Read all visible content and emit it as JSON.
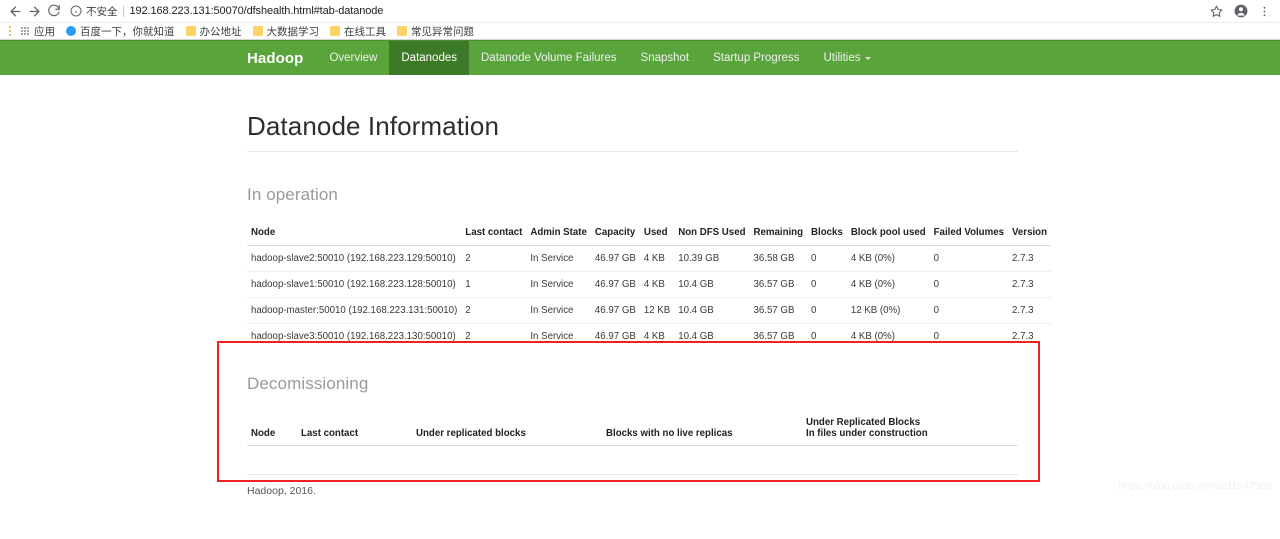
{
  "browser": {
    "back_label": "Back",
    "forward_label": "Forward",
    "reload_label": "Reload",
    "security_label": "不安全",
    "url": "192.168.223.131:50070/dfshealth.html#tab-datanode",
    "bookmark_star_label": "Bookmark this tab",
    "profile_label": "Profile",
    "menu_label": "Customize and control Google Chrome",
    "bookmarks": [
      {
        "label": "应用",
        "icon": "apps-icon"
      },
      {
        "label": "百度一下，你就知道",
        "icon": "baidu-icon"
      },
      {
        "label": "办公地址",
        "icon": "folder-icon"
      },
      {
        "label": "大数据学习",
        "icon": "folder-icon"
      },
      {
        "label": "在线工具",
        "icon": "folder-icon"
      },
      {
        "label": "常见异常问题",
        "icon": "folder-icon"
      }
    ]
  },
  "navbar": {
    "brand": "Hadoop",
    "accent_color": "#5aa43c",
    "active_color": "#3d7a27",
    "items": [
      {
        "label": "Overview",
        "active": false,
        "caret": false
      },
      {
        "label": "Datanodes",
        "active": true,
        "caret": false
      },
      {
        "label": "Datanode Volume Failures",
        "active": false,
        "caret": false
      },
      {
        "label": "Snapshot",
        "active": false,
        "caret": false
      },
      {
        "label": "Startup Progress",
        "active": false,
        "caret": false
      },
      {
        "label": "Utilities",
        "active": false,
        "caret": true
      }
    ]
  },
  "main": {
    "page_title": "Datanode Information",
    "in_operation": {
      "heading": "In operation",
      "columns": [
        "Node",
        "Last contact",
        "Admin State",
        "Capacity",
        "Used",
        "Non DFS Used",
        "Remaining",
        "Blocks",
        "Block pool used",
        "Failed Volumes",
        "Version"
      ],
      "rows": [
        {
          "node": "hadoop-slave2:50010 (192.168.223.129:50010)",
          "last_contact": "2",
          "admin_state": "In Service",
          "capacity": "46.97 GB",
          "used": "4 KB",
          "non_dfs_used": "10.39 GB",
          "remaining": "36.58 GB",
          "blocks": "0",
          "block_pool_used": "4 KB (0%)",
          "failed_volumes": "0",
          "version": "2.7.3"
        },
        {
          "node": "hadoop-slave1:50010 (192.168.223.128:50010)",
          "last_contact": "1",
          "admin_state": "In Service",
          "capacity": "46.97 GB",
          "used": "4 KB",
          "non_dfs_used": "10.4 GB",
          "remaining": "36.57 GB",
          "blocks": "0",
          "block_pool_used": "4 KB (0%)",
          "failed_volumes": "0",
          "version": "2.7.3"
        },
        {
          "node": "hadoop-master:50010 (192.168.223.131:50010)",
          "last_contact": "2",
          "admin_state": "In Service",
          "capacity": "46.97 GB",
          "used": "12 KB",
          "non_dfs_used": "10.4 GB",
          "remaining": "36.57 GB",
          "blocks": "0",
          "block_pool_used": "12 KB (0%)",
          "failed_volumes": "0",
          "version": "2.7.3"
        },
        {
          "node": "hadoop-slave3:50010 (192.168.223.130:50010)",
          "last_contact": "2",
          "admin_state": "In Service",
          "capacity": "46.97 GB",
          "used": "4 KB",
          "non_dfs_used": "10.4 GB",
          "remaining": "36.57 GB",
          "blocks": "0",
          "block_pool_used": "4 KB (0%)",
          "failed_volumes": "0",
          "version": "2.7.3"
        }
      ]
    },
    "decommissioning": {
      "heading": "Decomissioning",
      "columns": [
        {
          "line1": "Node",
          "line2": ""
        },
        {
          "line1": "Last contact",
          "line2": ""
        },
        {
          "line1": "Under replicated blocks",
          "line2": ""
        },
        {
          "line1": "Blocks with no live replicas",
          "line2": ""
        },
        {
          "line1": "Under Replicated Blocks",
          "line2": "In files under construction"
        }
      ],
      "rows": []
    }
  },
  "footer": {
    "text": "Hadoop, 2016."
  },
  "annotation": {
    "box_color": "#ef2222"
  },
  "watermark": {
    "text": "https://blog.csdn.net/u011047968"
  }
}
